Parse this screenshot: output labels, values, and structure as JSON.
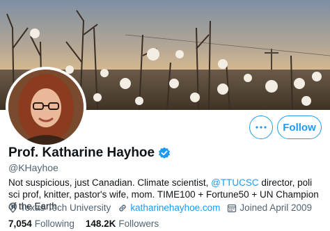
{
  "profile": {
    "name": "Prof. Katharine Hayhoe",
    "handle": "@KHayhoe",
    "bio": {
      "before": "Not suspicious, just Canadian. Climate scientist, ",
      "mention": "@TTUCSC",
      "after": " director, poli sci prof, knitter, pastor's wife, mom. TIME100 + Fortune50 + UN Champion of the Earth."
    },
    "location": "Texas Tech University",
    "website": "katharinehayhoe.com",
    "joined": "Joined April 2009",
    "following_count": "7,054",
    "following_label": "Following",
    "followers_count": "148.2K",
    "followers_label": "Followers"
  },
  "actions": {
    "follow_label": "Follow"
  },
  "colors": {
    "accent": "#1d9bf0",
    "secondary_text": "#536471",
    "primary_text": "#0f1419"
  },
  "icons": {
    "more": "more-options-icon",
    "verified": "verified-badge-icon",
    "location": "location-pin-icon",
    "link": "link-icon",
    "calendar": "calendar-icon"
  }
}
